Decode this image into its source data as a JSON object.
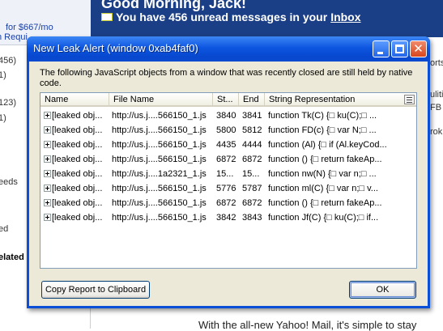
{
  "background": {
    "greeting": "Good Morning, Jack!",
    "unread_prefix": "You have 456 unread messages in your",
    "inbox_link": "Inbox",
    "left_lines": [
      "for $667/mo",
      "n Requi",
      "456)",
      "1)",
      "123)",
      "1)",
      "eeds",
      "ed",
      "elated",
      "l"
    ],
    "right_lines": [
      "orts",
      "uliti",
      "FB",
      "rok"
    ],
    "bottom_text": "With the all-new Yahoo! Mail, it's simple to stay"
  },
  "dialog": {
    "title": "New Leak Alert (window 0xab4faf0)",
    "description": "The following JavaScript objects from a window that was recently closed are still held by native code.",
    "columns": [
      "Name",
      "File Name",
      "St...",
      "End",
      "String Representation"
    ],
    "rows": [
      {
        "name": "[leaked obj...",
        "file": "http://us.j....566150_1.js",
        "start": "3840",
        "end": "3841",
        "repr": "function Tk(C) {□   ku(C);□    ..."
      },
      {
        "name": "[leaked obj...",
        "file": "http://us.j....566150_1.js",
        "start": "5800",
        "end": "5812",
        "repr": "function FD(c) {□    var N;□    ..."
      },
      {
        "name": "[leaked obj...",
        "file": "http://us.j....566150_1.js",
        "start": "4435",
        "end": "4444",
        "repr": "function (Al) {□    if (Al.keyCod..."
      },
      {
        "name": "[leaked obj...",
        "file": "http://us.j....566150_1.js",
        "start": "6872",
        "end": "6872",
        "repr": "function () {□    return fakeAp..."
      },
      {
        "name": "[leaked obj...",
        "file": "http://us.j....1a2321_1.js",
        "start": "15...",
        "end": "15...",
        "repr": "function nw(N) {□    var n;□    ..."
      },
      {
        "name": "[leaked obj...",
        "file": "http://us.j....566150_1.js",
        "start": "5776",
        "end": "5787",
        "repr": "function ml(C) {□    var n;□    v..."
      },
      {
        "name": "[leaked obj...",
        "file": "http://us.j....566150_1.js",
        "start": "6872",
        "end": "6872",
        "repr": "function () {□    return fakeAp..."
      },
      {
        "name": "[leaked obj...",
        "file": "http://us.j....566150_1.js",
        "start": "3842",
        "end": "3843",
        "repr": "function Jf(C) {□   ku(C);□    if..."
      }
    ],
    "copy_button": "Copy Report to Clipboard",
    "ok_button": "OK"
  },
  "colors": {
    "titlebar": "#0a4fd6",
    "dialog_face": "#ece9d8",
    "page_header": "#1b3f86"
  }
}
